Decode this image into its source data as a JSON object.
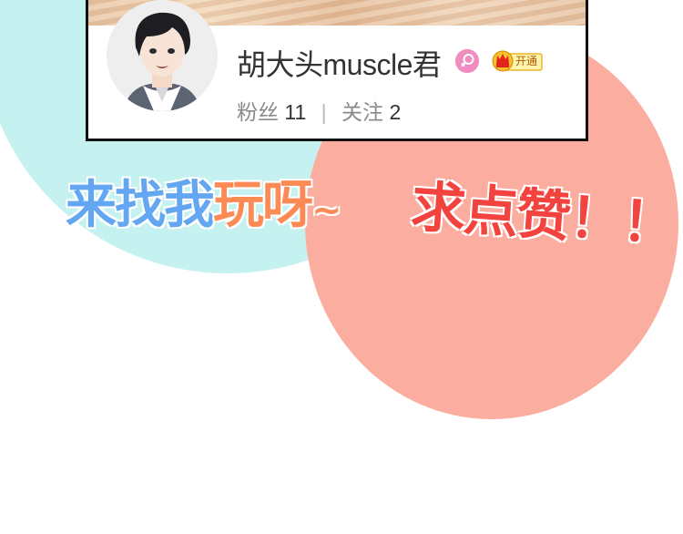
{
  "profile": {
    "username": "胡大头muscle君",
    "fans_label": "粉丝",
    "fans_count": "11",
    "separator": "|",
    "following_label": "关注",
    "following_count": "2",
    "vip_label": "开通",
    "gender_icon": "female-icon",
    "vip_icon": "crown-icon"
  },
  "slogans": {
    "left_part1": "来找我",
    "left_part2": "玩呀",
    "left_tilde": "~",
    "right": "求点赞！！"
  },
  "colors": {
    "cyan_blob": "#c5f1f1",
    "salmon_blob": "#fbaea0",
    "blue_text": "#63a6f2",
    "orange_text": "#fb8a55",
    "red_text": "#f2433f",
    "gender_pink": "#f08cc0",
    "vip_gold": "#f7c02c"
  }
}
